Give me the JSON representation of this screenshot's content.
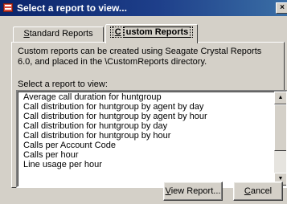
{
  "window": {
    "title": "Select a report to view...",
    "close_glyph": "×"
  },
  "tabs": [
    {
      "label_prefix": "",
      "label_ul": "S",
      "label_rest": "tandard Reports",
      "selected": false
    },
    {
      "label_prefix": "",
      "label_ul": "C",
      "label_rest": "ustom Reports",
      "selected": true
    }
  ],
  "description": "Custom reports can be created using Seagate Crystal Reports 6.0, and placed in the \\CustomReports directory.",
  "list": {
    "label": "Select a report to view:",
    "items": [
      "Average call duration for huntgroup",
      "Call distribution for huntgroup by agent by day",
      "Call distribution for huntgroup by agent by hour",
      "Call distribution for huntgroup by day",
      "Call distribution for huntgroup by hour",
      "Calls per Account Code",
      "Calls per hour",
      "Line usage per hour"
    ],
    "scroll_up_glyph": "▲",
    "scroll_down_glyph": "▼"
  },
  "buttons": {
    "view_ul": "V",
    "view_rest": "iew Report...",
    "cancel_ul": "C",
    "cancel_rest": "ancel"
  },
  "icons": {
    "title": "report-app-icon"
  }
}
